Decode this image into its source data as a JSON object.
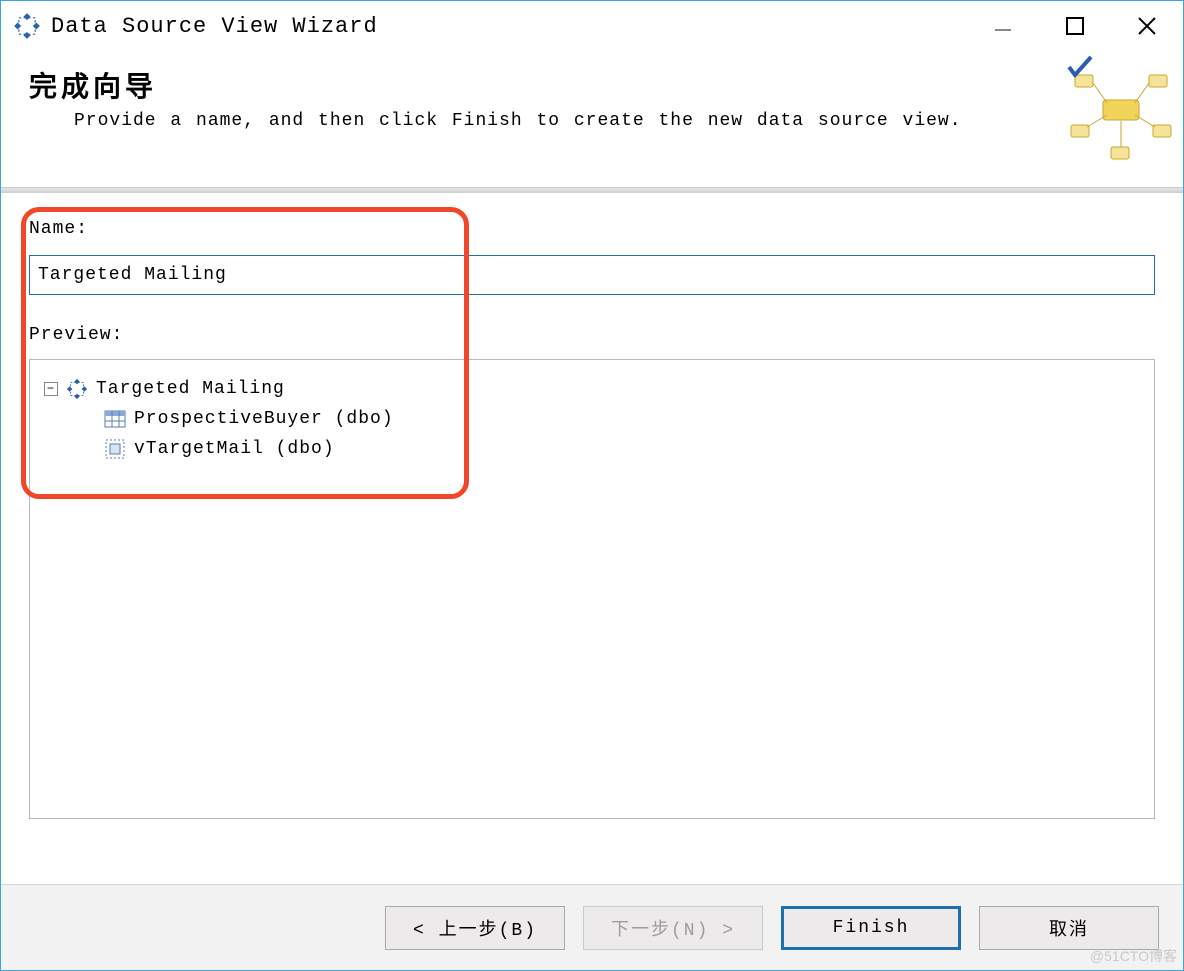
{
  "titlebar": {
    "title": "Data Source View Wizard"
  },
  "header": {
    "title": "完成向导",
    "subtitle": "Provide a name, and then click Finish to create the new data source view."
  },
  "form": {
    "name_label": "Name:",
    "name_value": "Targeted Mailing",
    "preview_label": "Preview:"
  },
  "tree": {
    "root": {
      "label": "Targeted Mailing",
      "icon": "dsv-icon",
      "expanded": true
    },
    "children": [
      {
        "label": "ProspectiveBuyer (dbo)",
        "icon": "table-icon"
      },
      {
        "label": "vTargetMail (dbo)",
        "icon": "view-icon"
      }
    ]
  },
  "buttons": {
    "back": "< 上一步(B)",
    "next": "下一步(N) >",
    "finish": "Finish",
    "cancel": "取消"
  },
  "watermark": "@51CTO博客"
}
